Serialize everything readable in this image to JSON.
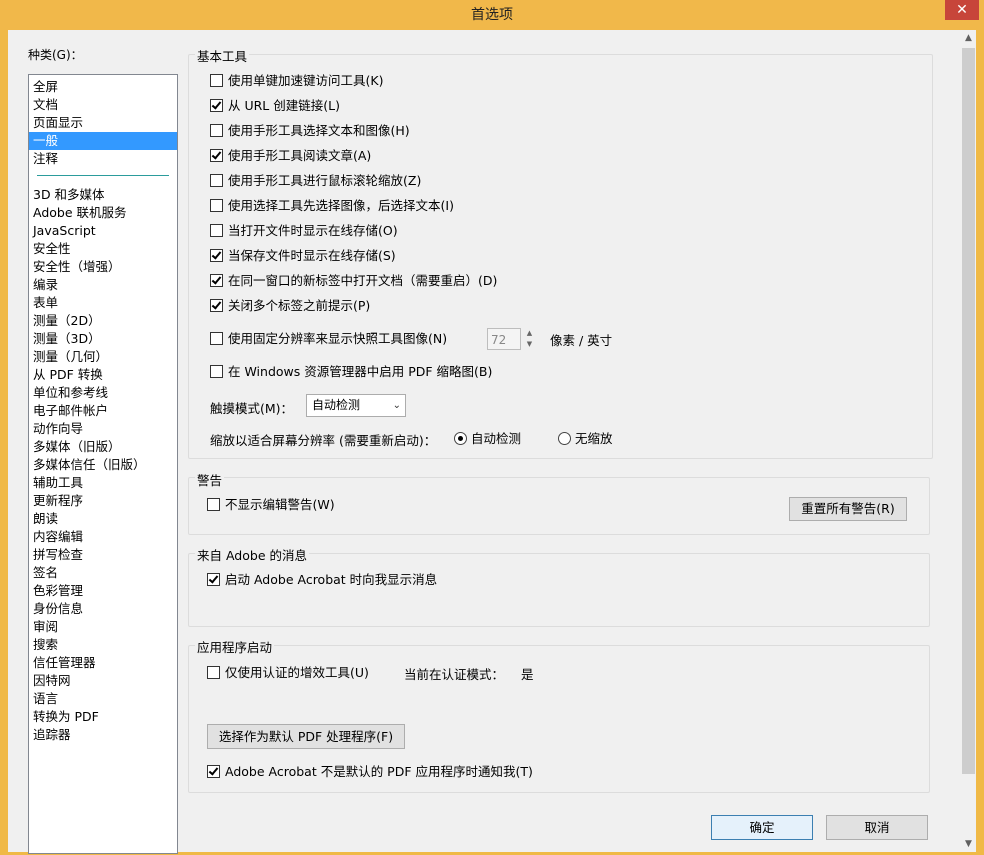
{
  "window": {
    "title": "首选项",
    "close_glyph": "✕"
  },
  "categories": {
    "label": "种类(G)：",
    "items_top": [
      "全屏",
      "文档",
      "页面显示",
      "一般",
      "注释"
    ],
    "selected": "一般",
    "items": [
      "3D 和多媒体",
      "Adobe 联机服务",
      "JavaScript",
      "安全性",
      "安全性（增强）",
      "编录",
      "表单",
      "测量（2D）",
      "测量（3D）",
      "测量（几何）",
      "从 PDF 转换",
      "单位和参考线",
      "电子邮件帐户",
      "动作向导",
      "多媒体（旧版）",
      "多媒体信任（旧版）",
      "辅助工具",
      "更新程序",
      "朗读",
      "内容编辑",
      "拼写检查",
      "签名",
      "色彩管理",
      "身份信息",
      "审阅",
      "搜索",
      "信任管理器",
      "因特网",
      "语言",
      "转换为 PDF",
      "追踪器"
    ]
  },
  "basic_tools": {
    "title": "基本工具",
    "options": [
      {
        "label": "使用单键加速键访问工具(K)",
        "checked": false
      },
      {
        "label": "从 URL 创建链接(L)",
        "checked": true
      },
      {
        "label": "使用手形工具选择文本和图像(H)",
        "checked": false
      },
      {
        "label": "使用手形工具阅读文章(A)",
        "checked": true
      },
      {
        "label": "使用手形工具进行鼠标滚轮缩放(Z)",
        "checked": false
      },
      {
        "label": "使用选择工具先选择图像，后选择文本(I)",
        "checked": false
      },
      {
        "label": "当打开文件时显示在线存储(O)",
        "checked": false
      },
      {
        "label": "当保存文件时显示在线存储(S)",
        "checked": true
      },
      {
        "label": "在同一窗口的新标签中打开文档（需要重启）(D)",
        "checked": true
      },
      {
        "label": "关闭多个标签之前提示(P)",
        "checked": true
      }
    ],
    "fixed_resolution": {
      "label": "使用固定分辨率来显示快照工具图像(N)",
      "checked": false,
      "value": "72",
      "unit": "像素 / 英寸"
    },
    "windows_thumbnail": {
      "label": "在 Windows 资源管理器中启用 PDF 缩略图(B)",
      "checked": false
    },
    "touch_mode": {
      "label": "触摸模式(M)：",
      "value": "自动检测"
    },
    "scaling": {
      "label": "缩放以适合屏幕分辨率 (需要重新启动)：",
      "option_auto": "自动检测",
      "option_none": "无缩放",
      "selected": "auto"
    }
  },
  "warnings": {
    "title": "警告",
    "dont_show": {
      "label": "不显示编辑警告(W)",
      "checked": false
    },
    "reset_button": "重置所有警告(R)"
  },
  "adobe_messages": {
    "title": "来自 Adobe 的消息",
    "show_on_launch": {
      "label": "启动 Adobe Acrobat 时向我显示消息",
      "checked": true
    }
  },
  "app_startup": {
    "title": "应用程序启动",
    "certified_only": {
      "label": "仅使用认证的增效工具(U)",
      "checked": false
    },
    "cert_mode_label": "当前在认证模式：",
    "cert_mode_value": "是",
    "default_handler_button": "选择作为默认 PDF 处理程序(F)",
    "notify_not_default": {
      "label": "Adobe Acrobat 不是默认的 PDF 应用程序时通知我(T)",
      "checked": true
    }
  },
  "footer": {
    "ok": "确定",
    "cancel": "取消"
  }
}
